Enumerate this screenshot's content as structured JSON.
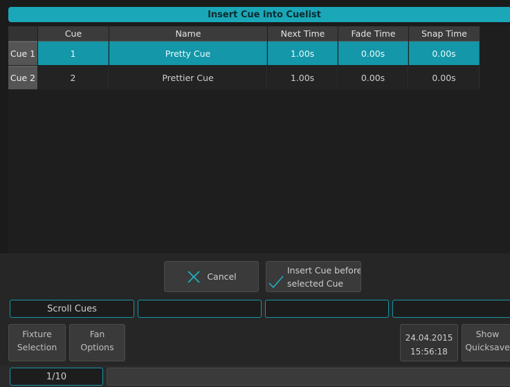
{
  "dialog": {
    "title": "Insert Cue into Cuelist"
  },
  "table": {
    "columns": [
      "Cue",
      "Name",
      "Next Time",
      "Fade Time",
      "Snap Time"
    ],
    "rows": [
      {
        "label": "Cue 1",
        "cue": "1",
        "name": "Pretty Cue",
        "next": "1.00s",
        "fade": "0.00s",
        "snap": "0.00s",
        "selected": true
      },
      {
        "label": "Cue 2",
        "cue": "2",
        "name": "Prettier Cue",
        "next": "1.00s",
        "fade": "0.00s",
        "snap": "0.00s",
        "selected": false
      }
    ]
  },
  "actions": {
    "cancel_label": "Cancel",
    "insert_line1": "Insert Cue before",
    "insert_line2": "selected Cue"
  },
  "fields": {
    "scroll_cues": "Scroll Cues",
    "f2": "",
    "f3": "",
    "f4": ""
  },
  "buttons": {
    "fixture_line1": "Fixture",
    "fixture_line2": "Selection",
    "fan_line1": "Fan",
    "fan_line2": "Options",
    "show_line1": "Show",
    "show_line2": "Quicksave"
  },
  "clock": {
    "date": "24.04.2015",
    "time": "15:56:18"
  },
  "pager": {
    "page": "1/10"
  },
  "colors": {
    "accent": "#1aa8b8",
    "selected_row": "#1497a8",
    "background": "#1b1b1b"
  }
}
